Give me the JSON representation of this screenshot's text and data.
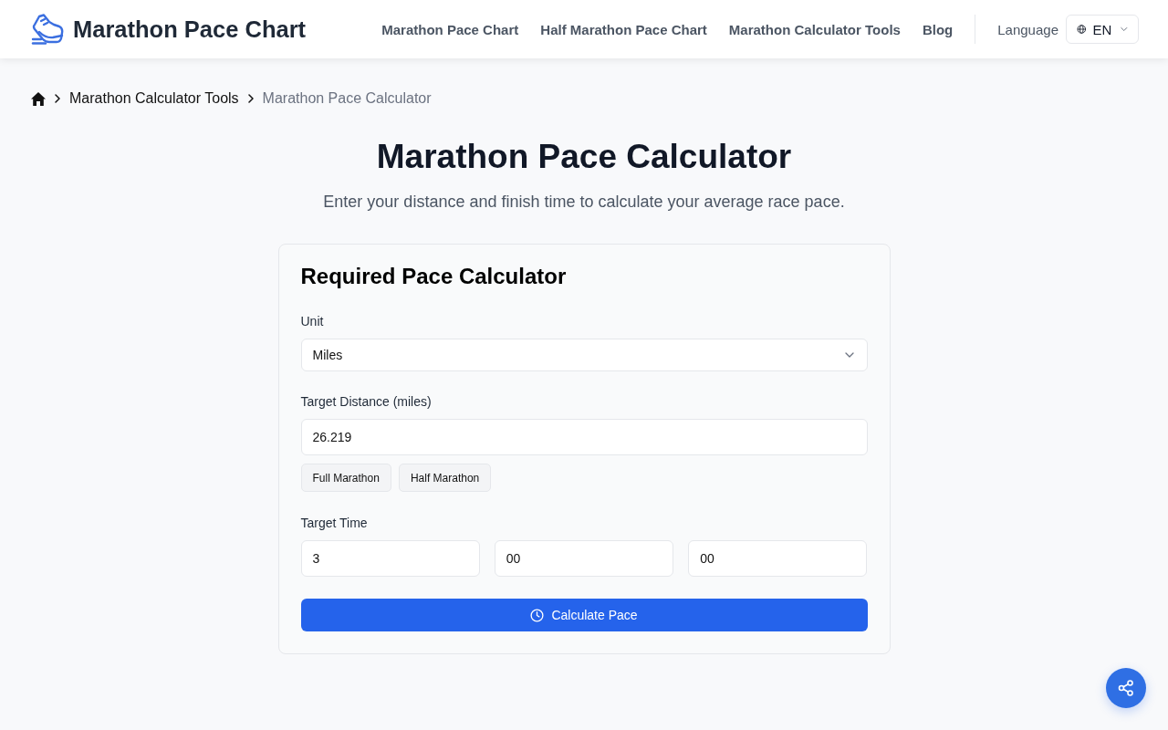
{
  "header": {
    "logo_text": "Marathon Pace Chart",
    "nav": [
      {
        "label": "Marathon Pace Chart"
      },
      {
        "label": "Half Marathon Pace Chart"
      },
      {
        "label": "Marathon Calculator Tools"
      },
      {
        "label": "Blog"
      }
    ],
    "language": {
      "label": "Language",
      "value": "EN"
    }
  },
  "breadcrumb": [
    {
      "label": "Marathon Calculator Tools",
      "current": false
    },
    {
      "label": "Marathon Pace Calculator",
      "current": true
    }
  ],
  "title": "Marathon Pace Calculator",
  "subtitle": "Enter your distance and finish time to calculate your average race pace.",
  "calculator": {
    "title": "Required Pace Calculator",
    "unit": {
      "label": "Unit",
      "value": "Miles"
    },
    "distance": {
      "label": "Target Distance (miles)",
      "value": "26.219",
      "presets": [
        "Full Marathon",
        "Half Marathon"
      ]
    },
    "time": {
      "label": "Target Time",
      "fields": [
        "3",
        "00",
        "00"
      ]
    },
    "button": "Calculate Pace"
  }
}
